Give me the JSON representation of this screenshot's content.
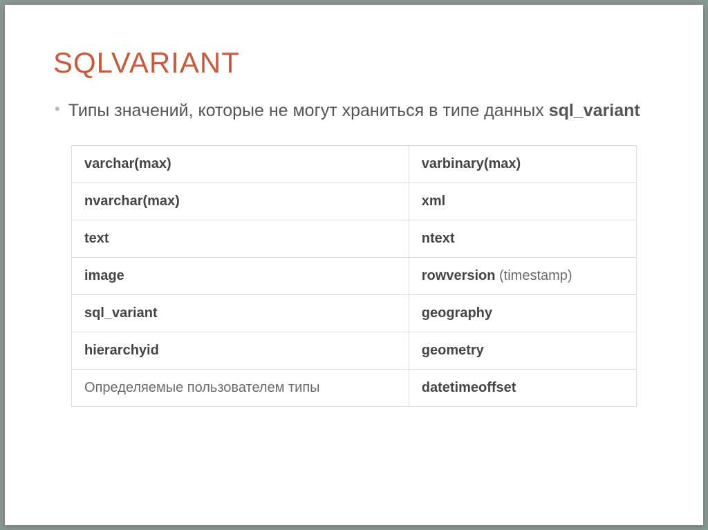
{
  "title": "SQLVARIANT",
  "bullet": {
    "pre": "Типы значений, которые не могут храниться в типе данных ",
    "strong": "sql_variant"
  },
  "table": {
    "rows": [
      {
        "left": "varchar(max)",
        "leftBold": true,
        "right": "varbinary(max)",
        "rightBold": true,
        "rightSpecial": false
      },
      {
        "left": "nvarchar(max)",
        "leftBold": true,
        "right": "xml",
        "rightBold": true,
        "rightSpecial": false
      },
      {
        "left": "text",
        "leftBold": true,
        "right": "ntext",
        "rightBold": true,
        "rightSpecial": false
      },
      {
        "left": "image",
        "leftBold": true,
        "right": "rowversion",
        "rightBold": true,
        "rightSpecial": true,
        "rightParen": " (timestamp)"
      },
      {
        "left": "sql_variant",
        "leftBold": true,
        "right": "geography",
        "rightBold": true,
        "rightSpecial": false
      },
      {
        "left": "hierarchyid",
        "leftBold": true,
        "right": "geometry",
        "rightBold": true,
        "rightSpecial": false
      },
      {
        "left": "Определяемые пользователем типы",
        "leftBold": false,
        "right": "datetimeoffset",
        "rightBold": true,
        "rightSpecial": false
      }
    ]
  }
}
